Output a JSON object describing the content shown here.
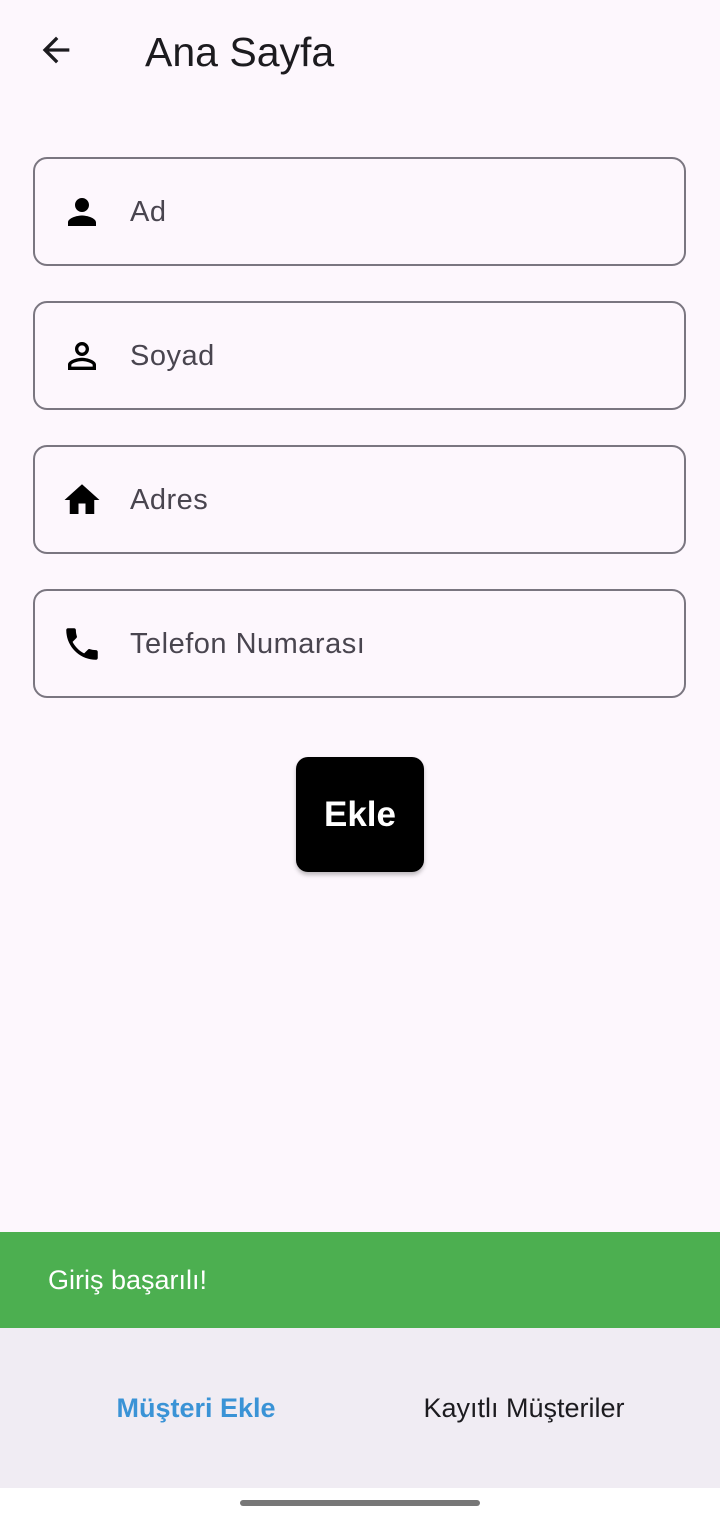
{
  "header": {
    "title": "Ana Sayfa",
    "back_icon": "arrow-back-icon"
  },
  "form": {
    "fields": [
      {
        "placeholder": "Ad",
        "icon": "person-icon"
      },
      {
        "placeholder": "Soyad",
        "icon": "person-outline-icon"
      },
      {
        "placeholder": "Adres",
        "icon": "home-icon"
      },
      {
        "placeholder": "Telefon Numarası",
        "icon": "phone-icon"
      }
    ],
    "submit_label": "Ekle"
  },
  "snackbar": {
    "message": "Giriş başarılı!",
    "color": "#4caf50"
  },
  "bottom_nav": {
    "items": [
      {
        "label": "Müşteri Ekle",
        "active": true
      },
      {
        "label": "Kayıtlı Müşteriler",
        "active": false
      }
    ],
    "active_color": "#3a93d6"
  },
  "colors": {
    "background": "#fdf7fd",
    "button": "#000000",
    "field_border": "#7a7680"
  }
}
